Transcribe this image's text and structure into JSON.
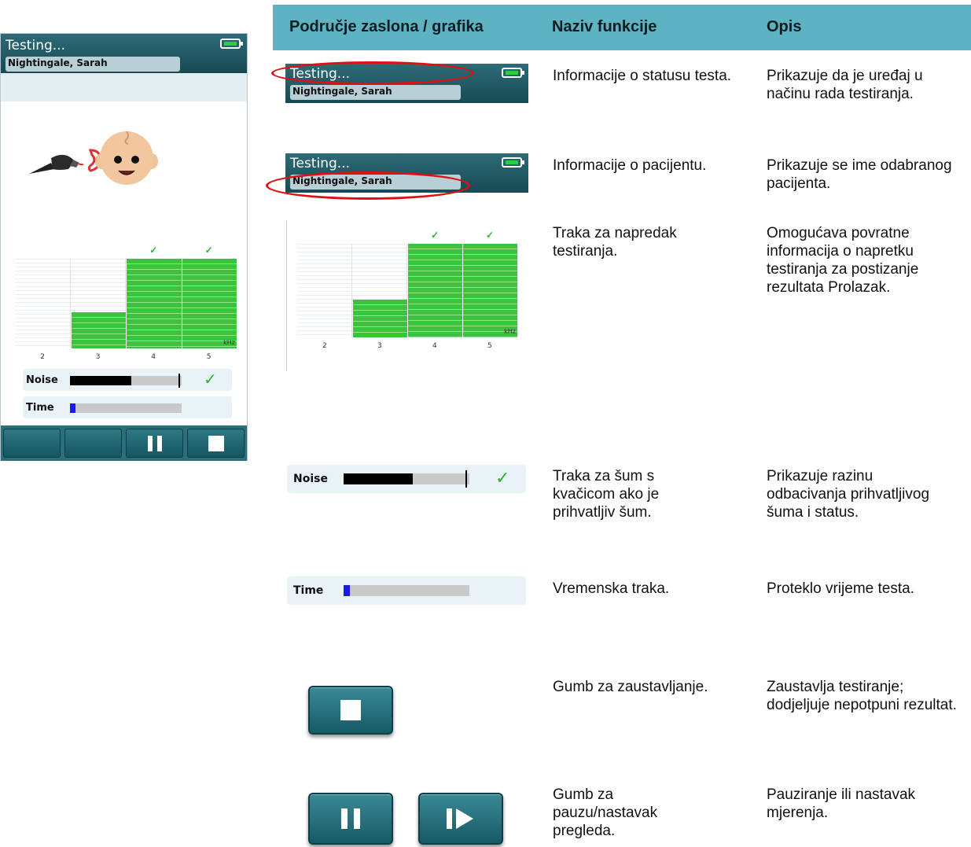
{
  "device": {
    "title": "Testing...",
    "patient": "Nightingale, Sarah",
    "progress": {
      "freq_labels": [
        "2",
        "3",
        "4",
        "5"
      ],
      "unit": "kHz",
      "fill_levels": [
        0.0,
        0.4,
        1.0,
        1.0
      ],
      "passed": [
        false,
        false,
        true,
        true
      ],
      "check_glyph": "✓"
    },
    "noise": {
      "label": "Noise",
      "level": 0.55,
      "threshold": 0.97,
      "accepted": true,
      "check_glyph": "✓"
    },
    "time": {
      "label": "Time",
      "elapsed": 0.05
    },
    "buttons": [
      "blank-button",
      "blank-button",
      "pause-icon",
      "stop-icon"
    ],
    "colors": {
      "header": "#1f5a66",
      "progress": "#3cc23c",
      "time_bar": "#1a1ae6"
    }
  },
  "table": {
    "headers": [
      "Područje zaslona / grafika",
      "Naziv funkcije",
      "Opis"
    ],
    "rows": [
      {
        "name": "Informacije o statusu testa.",
        "desc": "Prikazuje da je uređaj u načinu rada testiranja."
      },
      {
        "name": "Informacije o pacijentu.",
        "desc": "Prikazuje se ime odabranog pacijenta."
      },
      {
        "name": "Traka za napredak testiranja.",
        "desc": "Omogućava povratne informacija o napretku testiranja za postizanje rezultata Prolazak."
      },
      {
        "name": "Traka za šum s kvačicom ako je prihvatljiv šum.",
        "desc": "Prikazuje razinu odbacivanja prihvatljivog šuma i status."
      },
      {
        "name": "Vremenska traka.",
        "desc": "Proteklo vrijeme testa."
      },
      {
        "name": "Gumb za zaustavljanje.",
        "desc": "Zaustavlja testiranje; dodjeljuje nepotpuni rezultat."
      },
      {
        "name": "Gumb za pauzu/nastavak pregleda.",
        "desc": "Pauziranje ili nastavak mjerenja."
      }
    ],
    "header_color": "#5db3c1",
    "highlight_color": "#e01010"
  }
}
